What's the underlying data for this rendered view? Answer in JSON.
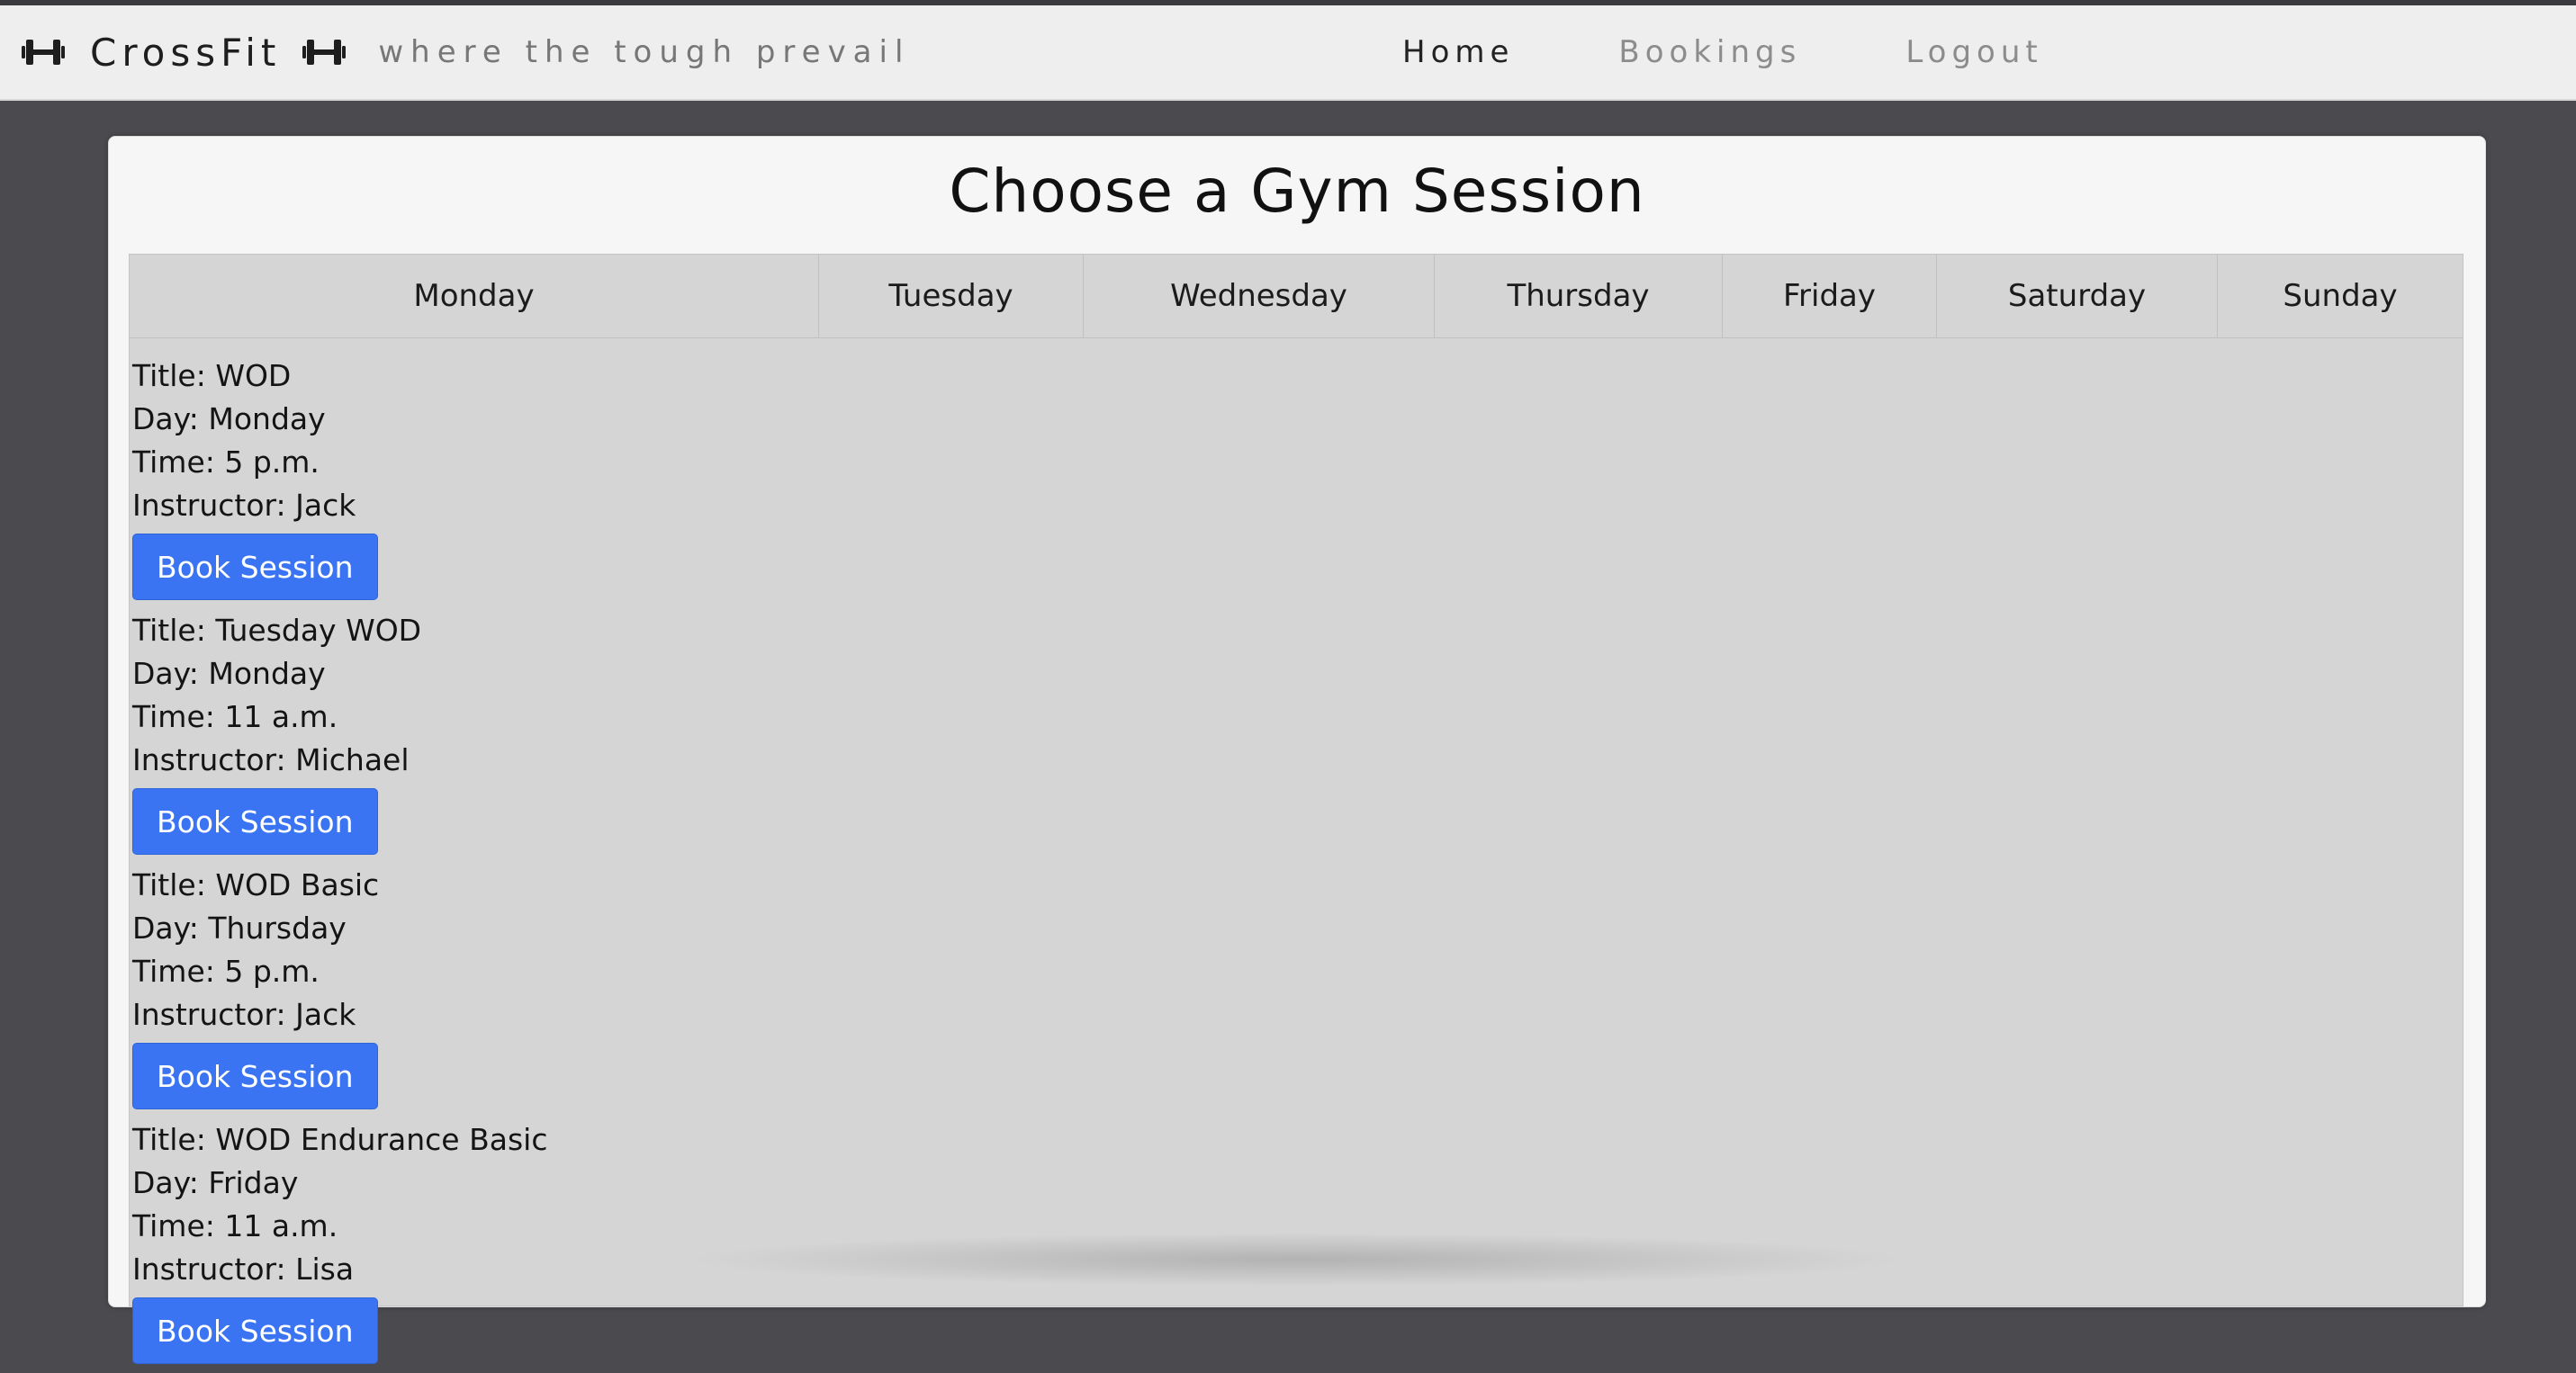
{
  "navbar": {
    "brand_name": "CrossFit",
    "tagline": "where the tough prevail",
    "links": [
      "Home",
      "Bookings",
      "Logout"
    ]
  },
  "page": {
    "title": "Choose a Gym Session"
  },
  "schedule": {
    "days": [
      "Monday",
      "Tuesday",
      "Wednesday",
      "Thursday",
      "Friday",
      "Saturday",
      "Sunday"
    ],
    "sessions": [
      {
        "title": "Title: WOD",
        "day": "Day: Monday",
        "time": "Time: 5 p.m.",
        "instructor": "Instructor: Jack",
        "button": "Book Session"
      },
      {
        "title": "Title: Tuesday WOD",
        "day": "Day: Monday",
        "time": "Time: 11 a.m.",
        "instructor": "Instructor: Michael",
        "button": "Book Session"
      },
      {
        "title": "Title: WOD Basic",
        "day": "Day: Thursday",
        "time": "Time: 5 p.m.",
        "instructor": "Instructor: Jack",
        "button": "Book Session"
      },
      {
        "title": "Title: WOD Endurance Basic",
        "day": "Day: Friday",
        "time": "Time: 11 a.m.",
        "instructor": "Instructor: Lisa",
        "button": "Book Session"
      }
    ]
  },
  "colors": {
    "button_bg": "#3b74f2",
    "page_bg": "#4a4a4f",
    "navbar_bg": "#eeeeee"
  },
  "icons": {
    "brand_left": "dumbbell-icon",
    "brand_right": "dumbbell-icon"
  }
}
